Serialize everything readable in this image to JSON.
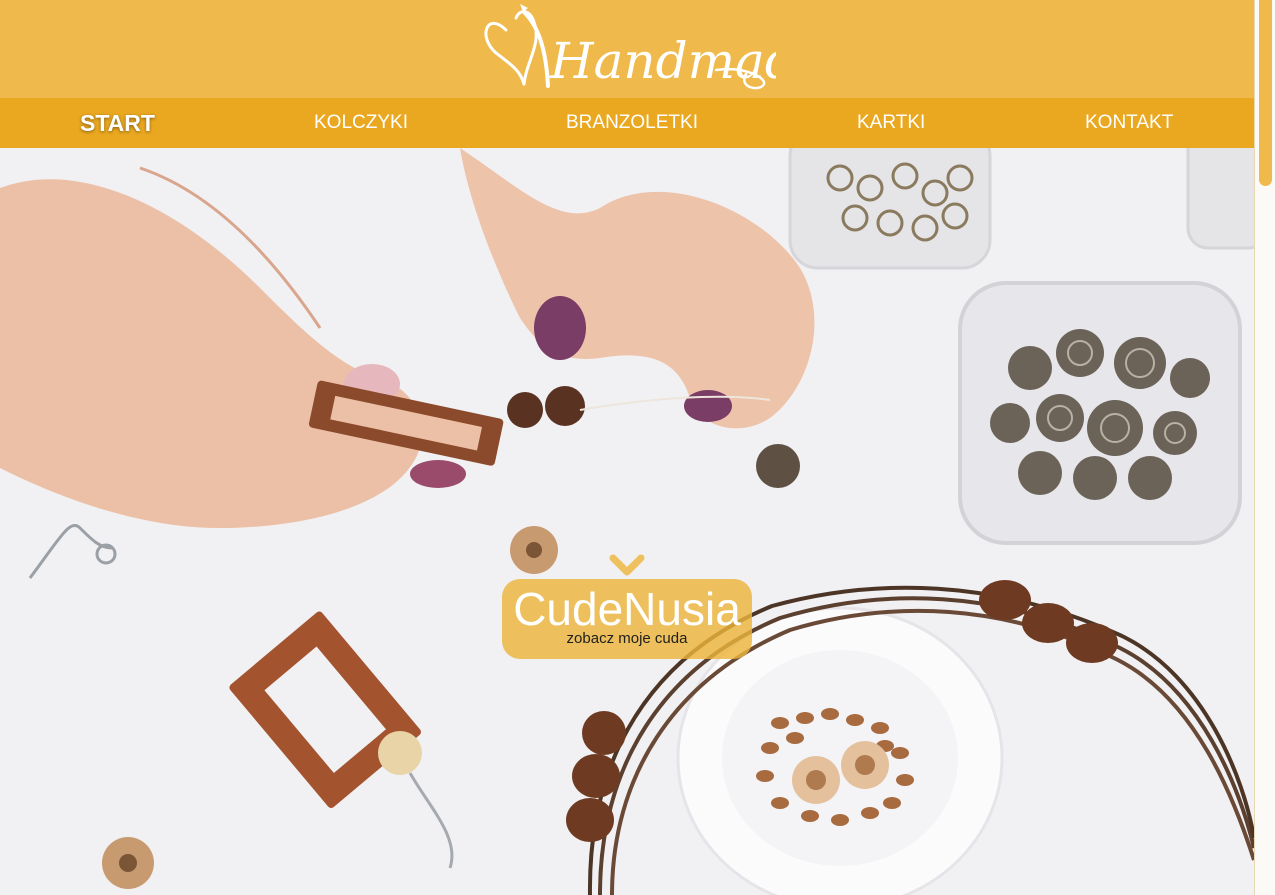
{
  "logo": {
    "text": "Handmade"
  },
  "nav": {
    "items": [
      {
        "label": "START"
      },
      {
        "label": "KOLCZYKI"
      },
      {
        "label": "BRANZOLETKI"
      },
      {
        "label": "KARTKI"
      },
      {
        "label": "KONTAKT"
      }
    ]
  },
  "hero": {
    "title": "CudeNusia",
    "subtitle": "zobacz moje cuda",
    "image": "hands-making-wooden-bead-jewelry"
  },
  "icons": {
    "down": "chevron-down-icon"
  },
  "colors": {
    "header": "#efb94c",
    "nav": "#eaa820",
    "badge": "#ecb43c"
  }
}
